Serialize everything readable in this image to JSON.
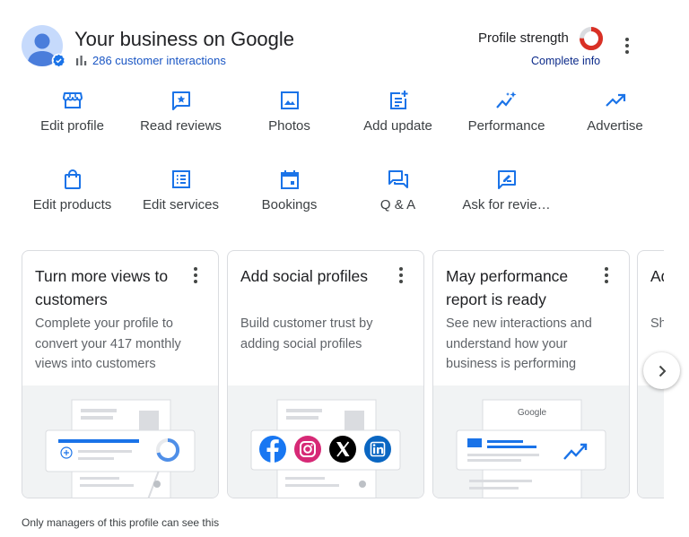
{
  "header": {
    "title": "Your business on Google",
    "interactions": "286 customer interactions",
    "profile_strength_label": "Profile strength",
    "profile_strength_fraction": 0.75,
    "complete_info": "Complete info"
  },
  "actions": [
    {
      "label": "Edit profile",
      "icon": "storefront-icon"
    },
    {
      "label": "Read reviews",
      "icon": "star-review-icon"
    },
    {
      "label": "Photos",
      "icon": "image-icon"
    },
    {
      "label": "Add update",
      "icon": "post-add-icon"
    },
    {
      "label": "Performance",
      "icon": "sparkle-chart-icon"
    },
    {
      "label": "Advertise",
      "icon": "trending-up-icon"
    },
    {
      "label": "Edit products",
      "icon": "shopping-bag-icon"
    },
    {
      "label": "Edit services",
      "icon": "list-alt-icon"
    },
    {
      "label": "Bookings",
      "icon": "calendar-icon"
    },
    {
      "label": "Q & A",
      "icon": "forum-icon"
    },
    {
      "label": "Ask for revie…",
      "icon": "rate-review-icon"
    }
  ],
  "cards": [
    {
      "title": "Turn more views to customers",
      "desc": "Complete your profile to convert your 417 monthly views into customers"
    },
    {
      "title": "Add social profiles",
      "desc": "Build customer trust by adding social profiles"
    },
    {
      "title": "May performance report is ready",
      "desc": "See new interactions and understand how your business is performing",
      "google_label": "Google"
    },
    {
      "title": "Ad",
      "desc": "Sh bu"
    }
  ],
  "footer_note": "Only managers of this profile can see this",
  "colors": {
    "accent": "#1a73e8",
    "text": "#202124",
    "muted": "#5f6368",
    "strength_red": "#d93025"
  }
}
